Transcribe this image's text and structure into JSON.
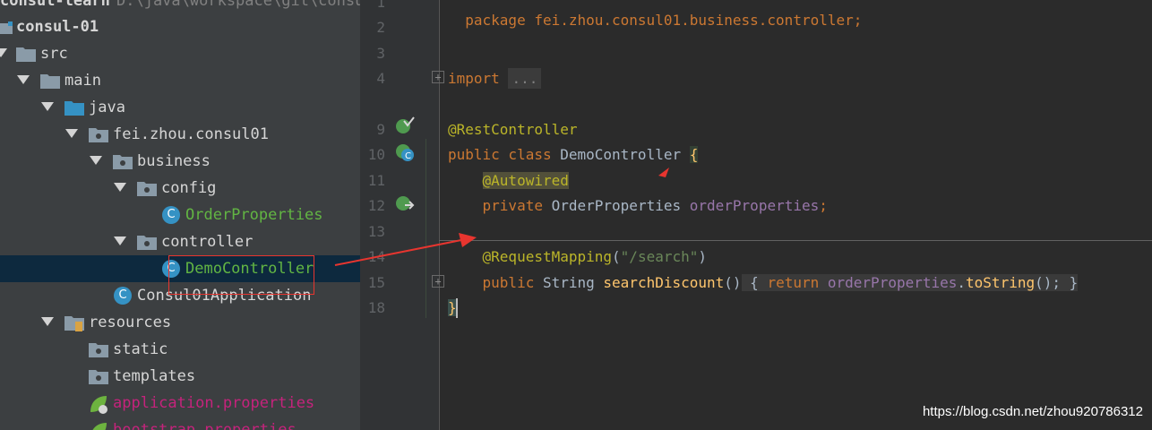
{
  "project_header": {
    "name": "consul-learn",
    "path": "D:\\java\\workspace\\git\\consu"
  },
  "tree": {
    "module": "consul-01",
    "src": "src",
    "main": "main",
    "java": "java",
    "package": "fei.zhou.consul01",
    "business": "business",
    "config": "config",
    "order_properties": "OrderProperties",
    "controller": "controller",
    "demo_controller": "DemoController",
    "application": "Consul01Application",
    "resources": "resources",
    "static": "static",
    "templates": "templates",
    "app_props": "application.properties",
    "bootstrap_props": "bootstrap.properties"
  },
  "line_numbers": [
    "1",
    "2",
    "3",
    "4",
    "9",
    "10",
    "11",
    "12",
    "13",
    "14",
    "15",
    "18"
  ],
  "code": {
    "l1": "package fei.zhou.consul01.business.controller;",
    "l4_kw": "import",
    "l4_fold": "...",
    "l9": "@RestController",
    "l10_kw": "public class",
    "l10_name": "DemoController",
    "l10_brace": "{",
    "l11": "@Autowired",
    "l12_kw": "private",
    "l12_type": "OrderProperties",
    "l12_field": "orderProperties",
    "l12_semi": ";",
    "l14_ann": "@RequestMapping",
    "l14_open": "(",
    "l14_str": "\"/search\"",
    "l14_close": ")",
    "l15_kw": "public",
    "l15_type": "String",
    "l15_method": "searchDiscount",
    "l15_parens": "()",
    "l15_open": "{",
    "l15_return": "return",
    "l15_field": "orderProperties",
    "l15_dot": ".",
    "l15_call": "toString",
    "l15_callp": "();",
    "l15_close": "}",
    "l18": "}"
  },
  "icons": {
    "folder": "folder-icon",
    "package": "package-icon",
    "class": "class-icon",
    "spring_boot": "spring-boot-run-icon",
    "bean": "spring-bean-icon",
    "fold": "fold-icon"
  },
  "colors": {
    "tree_bg": "#3c3f41",
    "editor_bg": "#2b2b2b",
    "selection": "#0d293e",
    "annotation_red": "#e8352f"
  },
  "watermark": "https://blog.csdn.net/zhou920786312"
}
